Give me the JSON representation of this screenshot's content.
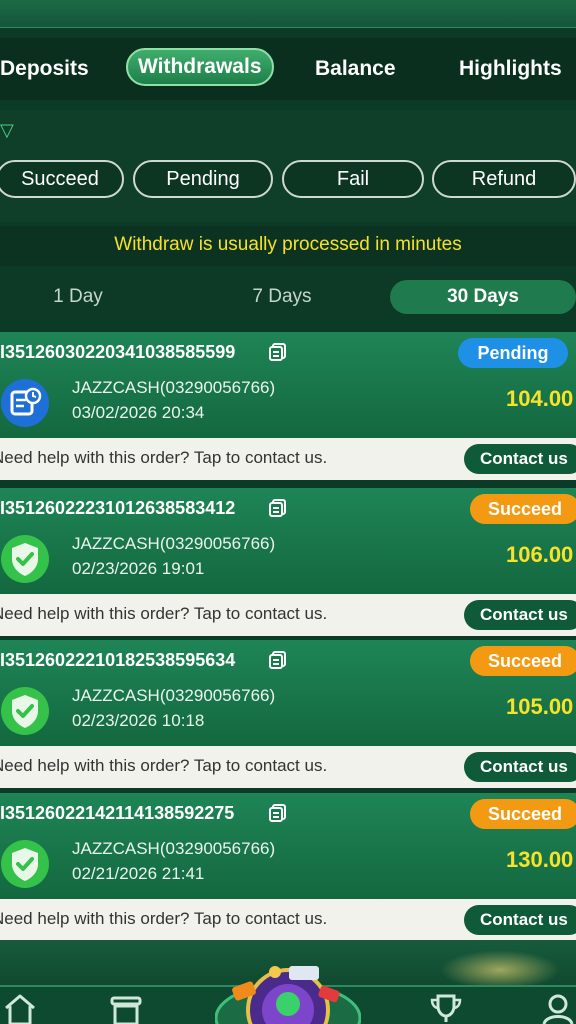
{
  "main_tabs": [
    "Deposits",
    "Withdrawals",
    "Balance",
    "Highlights"
  ],
  "active_main_tab": "Withdrawals",
  "status_filters": [
    "Succeed",
    "Pending",
    "Fail",
    "Refund"
  ],
  "notice": "Withdraw is usually processed in minutes",
  "day_tabs": [
    "1 Day",
    "7 Days",
    "30 Days"
  ],
  "active_day_tab": "30 Days",
  "orders": [
    {
      "id": "I35126030220341038585599",
      "status": "Pending",
      "channel": "JAZZCASH(03290056766)",
      "datetime": "03/02/2026 20:34",
      "amount": "104.00",
      "help_text": "Need help with this order? Tap to contact us.",
      "contact_label": "Contact us"
    },
    {
      "id": "I35126022231012638583412",
      "status": "Succeed",
      "channel": "JAZZCASH(03290056766)",
      "datetime": "02/23/2026 19:01",
      "amount": "106.00",
      "help_text": "Need help with this order? Tap to contact us.",
      "contact_label": "Contact us"
    },
    {
      "id": "I35126022210182538595634",
      "status": "Succeed",
      "channel": "JAZZCASH(03290056766)",
      "datetime": "02/23/2026 10:18",
      "amount": "105.00",
      "help_text": "Need help with this order? Tap to contact us.",
      "contact_label": "Contact us"
    },
    {
      "id": "I35126022142114138592275",
      "status": "Succeed",
      "channel": "JAZZCASH(03290056766)",
      "datetime": "02/21/2026 21:41",
      "amount": "130.00",
      "help_text": "Need help with this order? Tap to contact us.",
      "contact_label": "Contact us"
    }
  ],
  "colors": {
    "accent_green": "#1e8556",
    "pending_blue": "#1e90e6",
    "succeed_orange": "#f39a12",
    "amount_yellow": "#f8e32b",
    "notice_yellow": "#f4e22a"
  },
  "bottom_nav_icons": [
    "home-icon",
    "store-icon",
    "game-center-icon",
    "trophy-icon",
    "profile-icon"
  ]
}
